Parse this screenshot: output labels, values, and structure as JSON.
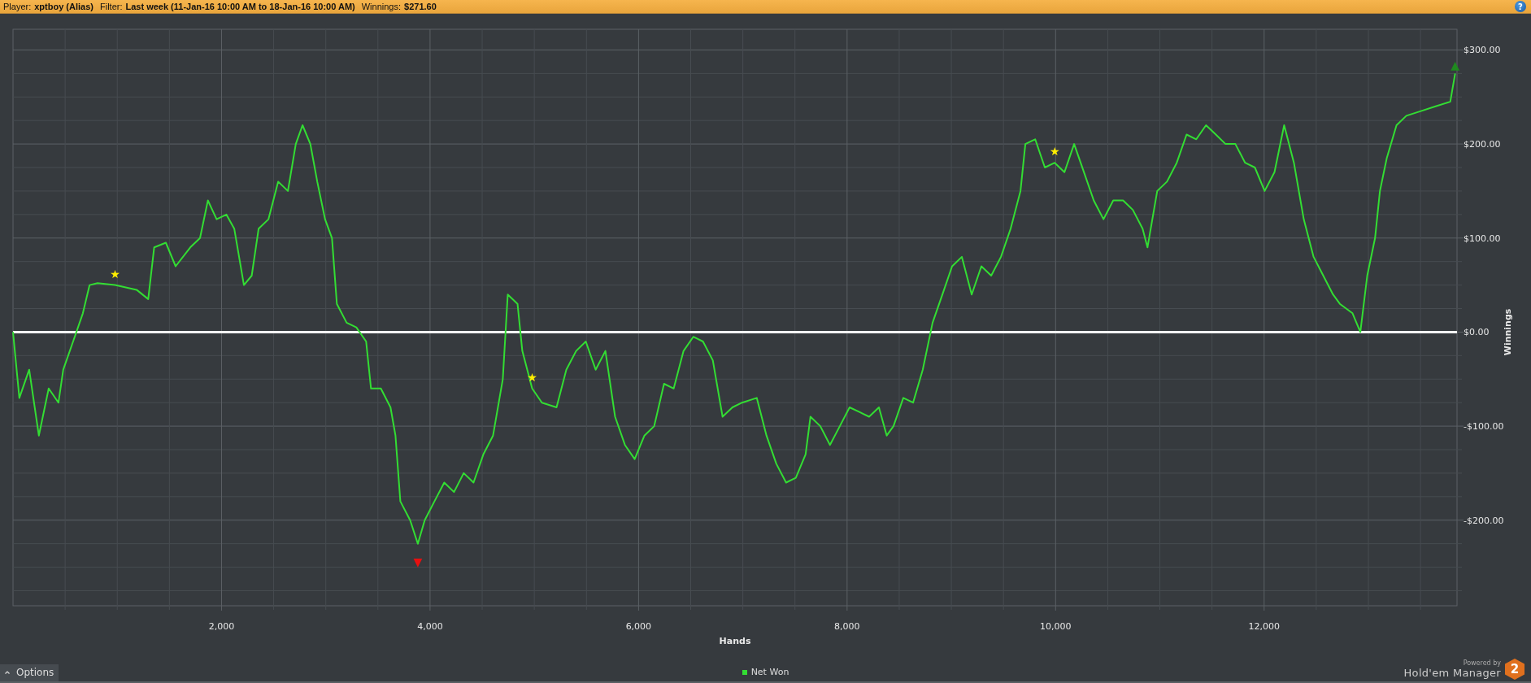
{
  "header": {
    "fields": [
      {
        "label": "Player:",
        "value": "xptboy (Alias)"
      },
      {
        "label": "Filter:",
        "value": "Last week (11-Jan-16 10:00 AM to 18-Jan-16 10:00 AM)"
      },
      {
        "label": "Winnings:",
        "value": "$271.60"
      }
    ],
    "help": "?"
  },
  "chart": {
    "chart_data": {
      "type": "line",
      "xlabel": "Hands",
      "ylabel": "Winnings",
      "xlim": [
        0,
        13850
      ],
      "ylim": [
        -291,
        322
      ],
      "xticks": [
        {
          "value": 2000,
          "label": "2,000"
        },
        {
          "value": 4000,
          "label": "4,000"
        },
        {
          "value": 6000,
          "label": "6,000"
        },
        {
          "value": 8000,
          "label": "8,000"
        },
        {
          "value": 10000,
          "label": "10,000"
        },
        {
          "value": 12000,
          "label": "12,000"
        }
      ],
      "yticks": [
        {
          "value": -200,
          "label": "-$200.00"
        },
        {
          "value": -100,
          "label": "-$100.00"
        },
        {
          "value": 0,
          "label": "$0.00"
        },
        {
          "value": 100,
          "label": "$100.00"
        },
        {
          "value": 200,
          "label": "$200.00"
        },
        {
          "value": 300,
          "label": "$300.00"
        }
      ],
      "x": [
        0,
        61,
        155,
        248,
        342,
        436,
        482,
        576,
        670,
        735,
        810,
        979,
        1185,
        1297,
        1354,
        1466,
        1560,
        1700,
        1794,
        1869,
        1953,
        2047,
        2122,
        2215,
        2290,
        2356,
        2450,
        2543,
        2637,
        2712,
        2777,
        2852,
        2918,
        2993,
        3059,
        3106,
        3200,
        3293,
        3387,
        3434,
        3528,
        3621,
        3668,
        3715,
        3809,
        3883,
        3949,
        4042,
        4136,
        4230,
        4323,
        4417,
        4511,
        4604,
        4698,
        4745,
        4839,
        4885,
        4979,
        5073,
        5213,
        5307,
        5401,
        5494,
        5588,
        5682,
        5775,
        5869,
        5963,
        6056,
        6150,
        6244,
        6337,
        6431,
        6525,
        6618,
        6712,
        6806,
        6900,
        6993,
        7134,
        7227,
        7321,
        7415,
        7508,
        7602,
        7649,
        7743,
        7836,
        7930,
        8024,
        8117,
        8211,
        8305,
        8380,
        8445,
        8539,
        8633,
        8726,
        8820,
        8914,
        9007,
        9101,
        9195,
        9288,
        9382,
        9476,
        9569,
        9663,
        9710,
        9804,
        9897,
        9991,
        10085,
        10178,
        10272,
        10366,
        10459,
        10553,
        10647,
        10741,
        10834,
        10881,
        10975,
        11068,
        11162,
        11256,
        11349,
        11443,
        11537,
        11630,
        11724,
        11818,
        11911,
        12005,
        12099,
        12192,
        12286,
        12380,
        12474,
        12567,
        12661,
        12726,
        12848,
        12923,
        12989,
        13064,
        13111,
        13176,
        13270,
        13364,
        13504,
        13645,
        13785,
        13832
      ],
      "series": [
        {
          "name": "Net Won",
          "color": "#33dd33",
          "values": [
            0,
            -70,
            -40,
            -110,
            -60,
            -75,
            -40,
            -10,
            20,
            50,
            52,
            50,
            45,
            35,
            90,
            95,
            70,
            90,
            100,
            140,
            120,
            125,
            110,
            50,
            60,
            110,
            120,
            160,
            150,
            200,
            220,
            200,
            160,
            120,
            100,
            30,
            10,
            5,
            -10,
            -60,
            -60,
            -80,
            -110,
            -180,
            -200,
            -225,
            -200,
            -180,
            -160,
            -170,
            -150,
            -160,
            -130,
            -110,
            -50,
            40,
            30,
            -20,
            -60,
            -75,
            -80,
            -40,
            -20,
            -10,
            -40,
            -20,
            -90,
            -120,
            -135,
            -110,
            -100,
            -55,
            -60,
            -20,
            -5,
            -10,
            -30,
            -90,
            -80,
            -75,
            -70,
            -110,
            -140,
            -160,
            -155,
            -130,
            -90,
            -100,
            -120,
            -100,
            -80,
            -85,
            -90,
            -80,
            -110,
            -100,
            -70,
            -75,
            -40,
            10,
            40,
            70,
            80,
            40,
            70,
            60,
            80,
            110,
            150,
            200,
            205,
            175,
            180,
            170,
            200,
            170,
            140,
            120,
            140,
            140,
            130,
            110,
            90,
            150,
            160,
            180,
            210,
            205,
            220,
            210,
            200,
            200,
            180,
            175,
            150,
            170,
            220,
            180,
            120,
            80,
            60,
            40,
            30,
            20,
            0,
            60,
            100,
            150,
            185,
            220,
            230,
            235,
            240,
            245,
            275
          ]
        }
      ],
      "grid": true,
      "annotations": [
        {
          "text": "★",
          "x": 979,
          "y": 50
        },
        {
          "text": "★",
          "x": 4979,
          "y": -60
        },
        {
          "text": "★",
          "x": 9991,
          "y": 180
        },
        {
          "text": "▼",
          "x": 3883,
          "y": -225
        },
        {
          "text": "▲",
          "x": 13832,
          "y": 275
        }
      ]
    }
  },
  "footer": {
    "options": "Options",
    "brand": {
      "tagline": "Powered by",
      "name": "Hold'em Manager",
      "badge": "2"
    }
  }
}
